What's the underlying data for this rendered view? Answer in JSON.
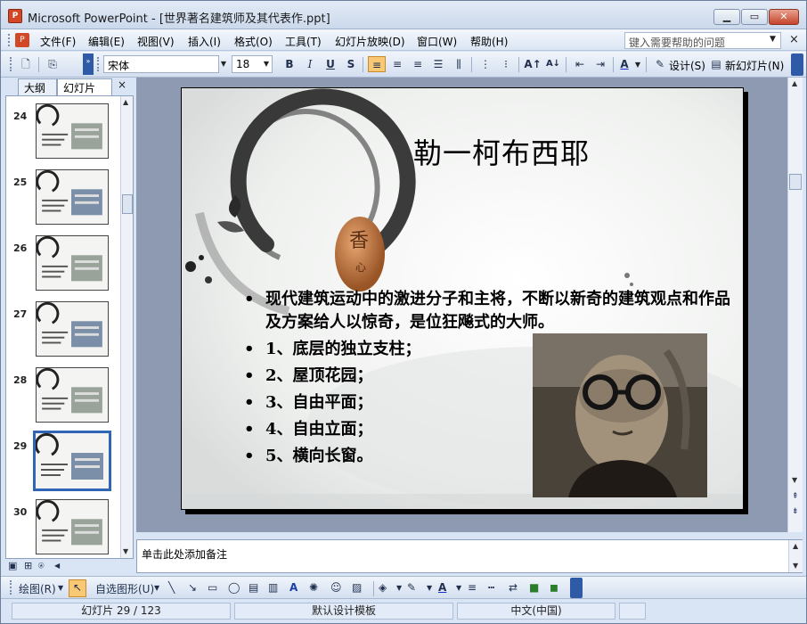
{
  "window": {
    "app_icon": "ppt-app-icon",
    "title": "Microsoft PowerPoint - [世界著名建筑师及其代表作.ppt]",
    "minimize_icon": "minimize-icon",
    "maximize_icon": "maximize-icon",
    "close_icon": "close-icon"
  },
  "menubar": {
    "items": [
      "文件(F)",
      "编辑(E)",
      "视图(V)",
      "插入(I)",
      "格式(O)",
      "工具(T)",
      "幻灯片放映(D)",
      "窗口(W)",
      "帮助(H)"
    ],
    "help_placeholder": "键入需要帮助的问题",
    "close_symbol": "×"
  },
  "toolbar": {
    "font_name": "宋体",
    "font_size": "18",
    "bold": "B",
    "italic": "I",
    "underline": "U",
    "shadow": "S",
    "design_label": "设计(S)",
    "new_slide_label": "新幻灯片(N)"
  },
  "panes": {
    "tab_outline": "大纲",
    "tab_slides": "幻灯片",
    "close_symbol": "×"
  },
  "thumbnails": [
    {
      "number": "24"
    },
    {
      "number": "25"
    },
    {
      "number": "26"
    },
    {
      "number": "27"
    },
    {
      "number": "28"
    },
    {
      "number": "29",
      "selected": true
    },
    {
      "number": "30"
    }
  ],
  "slide": {
    "title": "勒一柯布西耶",
    "bullets": [
      "现代建筑运动中的激进分子和主将，不断以新奇的建筑观点和作品及方案给人以惊奇，是位狂飚式的大师。",
      "1、底层的独立支柱；",
      "2、屋顶花园；",
      "3、自由平面；",
      "4、自由立面；",
      "5、横向长窗。"
    ],
    "bullet_symbol": "•"
  },
  "notes": {
    "placeholder": "单击此处添加备注"
  },
  "drawbar": {
    "draw_label": "绘图(R)",
    "autoshapes_label": "自选图形(U)"
  },
  "statusbar": {
    "slide_position": "幻灯片 29 / 123",
    "template": "默认设计模板",
    "language": "中文(中国)"
  },
  "colors": {
    "selection_border": "#3165b5",
    "edit_background": "#8e9ab1",
    "close_button": "#c6432a"
  }
}
